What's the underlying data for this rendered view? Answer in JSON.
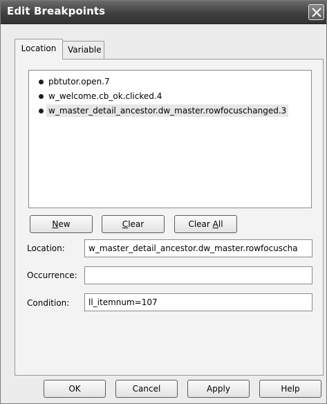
{
  "window": {
    "title": "Edit Breakpoints"
  },
  "tabs": [
    {
      "label": "Location",
      "active": true
    },
    {
      "label": "Variable",
      "active": false
    }
  ],
  "breakpoints": [
    {
      "text": "pbtutor.open.7",
      "selected": false
    },
    {
      "text": "w_welcome.cb_ok.clicked.4",
      "selected": false
    },
    {
      "text": "w_master_detail_ancestor.dw_master.rowfocuschanged.3",
      "selected": true
    }
  ],
  "list_buttons": {
    "new_prefix": "",
    "new_mnemonic": "N",
    "new_rest": "ew",
    "clear_mnemonic": "C",
    "clear_rest": "lear",
    "clear_all_prefix": "Clear ",
    "clear_all_mnemonic": "A",
    "clear_all_rest": "ll"
  },
  "fields": {
    "location_label": "Location:",
    "location_value": "w_master_detail_ancestor.dw_master.rowfocuscha",
    "occurrence_label": "Occurrence:",
    "occurrence_value": "",
    "condition_label": "Condition:",
    "condition_value": "ll_itemnum=107"
  },
  "dialog_buttons": {
    "ok": "OK",
    "cancel": "Cancel",
    "apply": "Apply",
    "help": "Help"
  },
  "icons": {
    "close": "close-icon",
    "bullet": "breakpoint-bullet-icon"
  }
}
